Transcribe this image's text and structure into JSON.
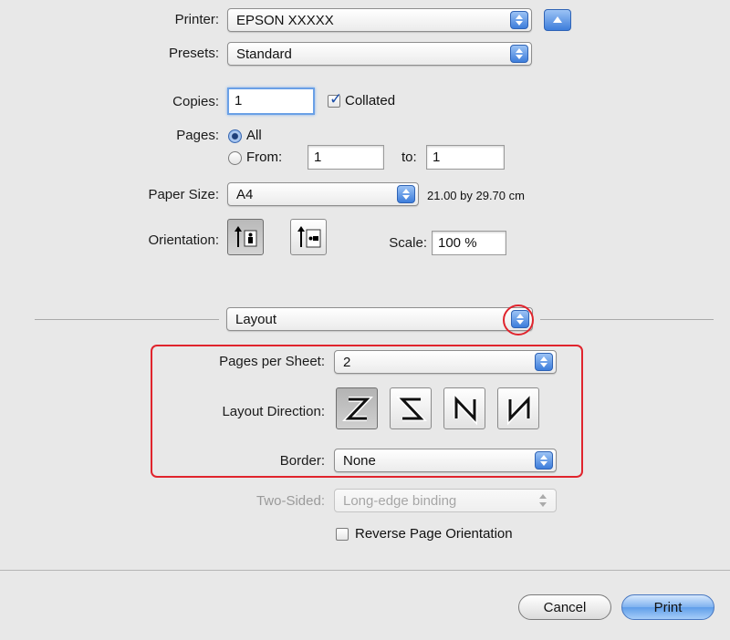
{
  "printer": {
    "label": "Printer:",
    "value": "EPSON XXXXX"
  },
  "presets": {
    "label": "Presets:",
    "value": "Standard"
  },
  "copies": {
    "label": "Copies:",
    "value": "1",
    "collated_label": "Collated",
    "collated_checked": true
  },
  "pages": {
    "label": "Pages:",
    "all_label": "All",
    "from_label": "From:",
    "from_value": "1",
    "to_label": "to:",
    "to_value": "1"
  },
  "paper_size": {
    "label": "Paper Size:",
    "value": "A4",
    "dimensions": "21.00 by 29.70 cm"
  },
  "orientation": {
    "label": "Orientation:",
    "selected": "portrait"
  },
  "scale": {
    "label": "Scale:",
    "value": "100 %"
  },
  "section_popup": {
    "value": "Layout"
  },
  "layout": {
    "pages_per_sheet_label": "Pages per Sheet:",
    "pages_per_sheet_value": "2",
    "layout_direction_label": "Layout Direction:",
    "directions": [
      "Z",
      "S",
      "N-reversed",
      "N"
    ],
    "selected_direction": "Z",
    "border_label": "Border:",
    "border_value": "None",
    "two_sided_label": "Two-Sided:",
    "two_sided_value": "Long-edge binding",
    "reverse_label": "Reverse Page Orientation"
  },
  "buttons": {
    "cancel": "Cancel",
    "print": "Print"
  },
  "colors": {
    "highlight": "#e0242d",
    "accent": "#3d7ddb"
  }
}
